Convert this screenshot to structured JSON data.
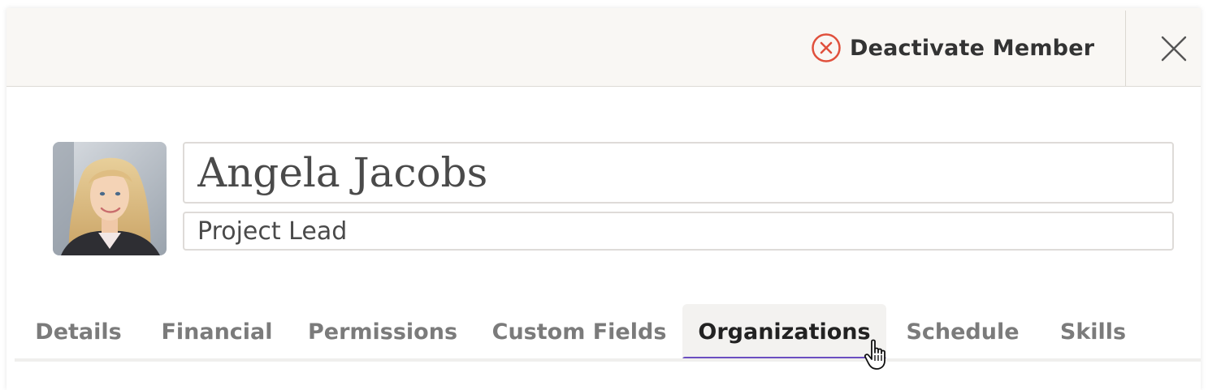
{
  "header": {
    "deactivate_label": "Deactivate Member",
    "deactivate_icon": "x-circle-icon",
    "close_icon": "close-icon"
  },
  "member": {
    "name": "Angela Jacobs",
    "title": "Project Lead",
    "avatar": "avatar-photo"
  },
  "tabs": [
    {
      "label": "Details",
      "active": false
    },
    {
      "label": "Financial",
      "active": false
    },
    {
      "label": "Permissions",
      "active": false
    },
    {
      "label": "Custom Fields",
      "active": false
    },
    {
      "label": "Organizations",
      "active": true
    },
    {
      "label": "Schedule",
      "active": false
    },
    {
      "label": "Skills",
      "active": false
    }
  ],
  "colors": {
    "accent": "#6b4fc1",
    "danger": "#e0503c",
    "header_bg": "#f9f7f4"
  }
}
